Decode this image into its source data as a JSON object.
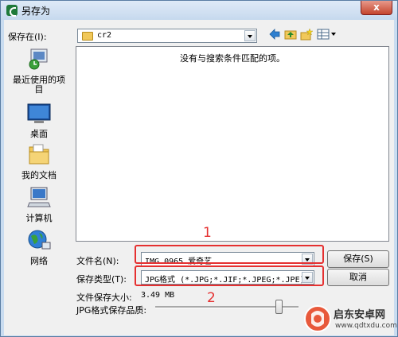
{
  "window": {
    "title": "另存为",
    "close_symbol": "x"
  },
  "save_in": {
    "label": "保存在(I):",
    "value": "cr2"
  },
  "places": [
    {
      "id": "recent",
      "label": "最近使用的项目"
    },
    {
      "id": "desktop",
      "label": "桌面"
    },
    {
      "id": "documents",
      "label": "我的文档"
    },
    {
      "id": "computer",
      "label": "计算机"
    },
    {
      "id": "network",
      "label": "网络"
    }
  ],
  "list": {
    "empty_message": "没有与搜索条件匹配的项。"
  },
  "file_name": {
    "label": "文件名(N):",
    "value": "IMG_0965_爱奇艺"
  },
  "file_type": {
    "label": "保存类型(T):",
    "value": "JPG格式 (*.JPG;*.JIF;*.JPEG;*.JPE)"
  },
  "file_size": {
    "label": "文件保存大小:",
    "value": "3.49 MB"
  },
  "quality": {
    "label": "JPG格式保存品质:",
    "level_fraction": 0.86
  },
  "buttons": {
    "save": "保存(S)",
    "cancel": "取消"
  },
  "annotations": {
    "one": "1",
    "two": "2"
  },
  "watermark": {
    "brand": "启东安卓网",
    "url": "www.qdtxdu.com"
  },
  "colors": {
    "highlight": "#e53030",
    "accent": "#1f7a3a"
  }
}
